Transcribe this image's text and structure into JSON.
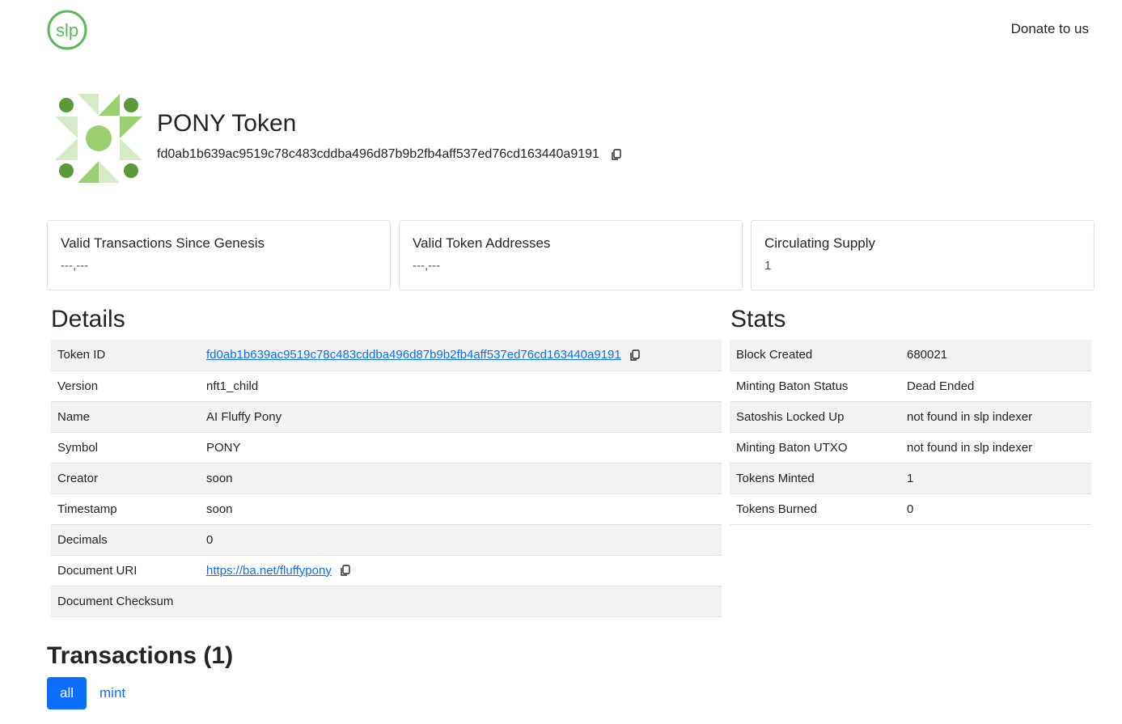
{
  "header": {
    "logo_text": "slp",
    "donate_label": "Donate to us",
    "brand_color": "#5cb85c"
  },
  "token": {
    "name": "PONY Token",
    "id": "fd0ab1b639ac9519c78c483cddba496d87b9b2fb4aff537ed76cd163440a9191",
    "icon": "identicon-icon",
    "icon_colors": [
      "#5b9a3a",
      "#9ccf6f",
      "#d6ebc5"
    ]
  },
  "cards": [
    {
      "title": "Valid Transactions Since Genesis",
      "value": "---,---"
    },
    {
      "title": "Valid Token Addresses",
      "value": "---,---"
    },
    {
      "title": "Circulating Supply",
      "value": "1"
    }
  ],
  "details": {
    "title": "Details",
    "rows": [
      {
        "label": "Token ID",
        "value": "fd0ab1b639ac9519c78c483cddba496d87b9b2fb4aff537ed76cd163440a9191"
      },
      {
        "label": "Version",
        "value": "nft1_child"
      },
      {
        "label": "Name",
        "value": "AI Fluffy Pony"
      },
      {
        "label": "Symbol",
        "value": "PONY"
      },
      {
        "label": "Creator",
        "value": "soon"
      },
      {
        "label": "Timestamp",
        "value": "soon"
      },
      {
        "label": "Decimals",
        "value": "0"
      },
      {
        "label": "Document URI",
        "value": "https://ba.net/fluffypony"
      },
      {
        "label": "Document Checksum",
        "value": ""
      }
    ]
  },
  "stats": {
    "title": "Stats",
    "rows": [
      {
        "label": "Block Created",
        "value": "680021"
      },
      {
        "label": "Minting Baton Status",
        "value": "Dead Ended"
      },
      {
        "label": "Satoshis Locked Up",
        "value": "not found in slp indexer"
      },
      {
        "label": "Minting Baton UTXO",
        "value": "not found in slp indexer"
      },
      {
        "label": "Tokens Minted",
        "value": "1"
      },
      {
        "label": "Tokens Burned",
        "value": "0"
      }
    ]
  },
  "transactions": {
    "title": "Transactions (1)",
    "tabs": [
      "all",
      "mint"
    ],
    "active_tab": "all"
  }
}
